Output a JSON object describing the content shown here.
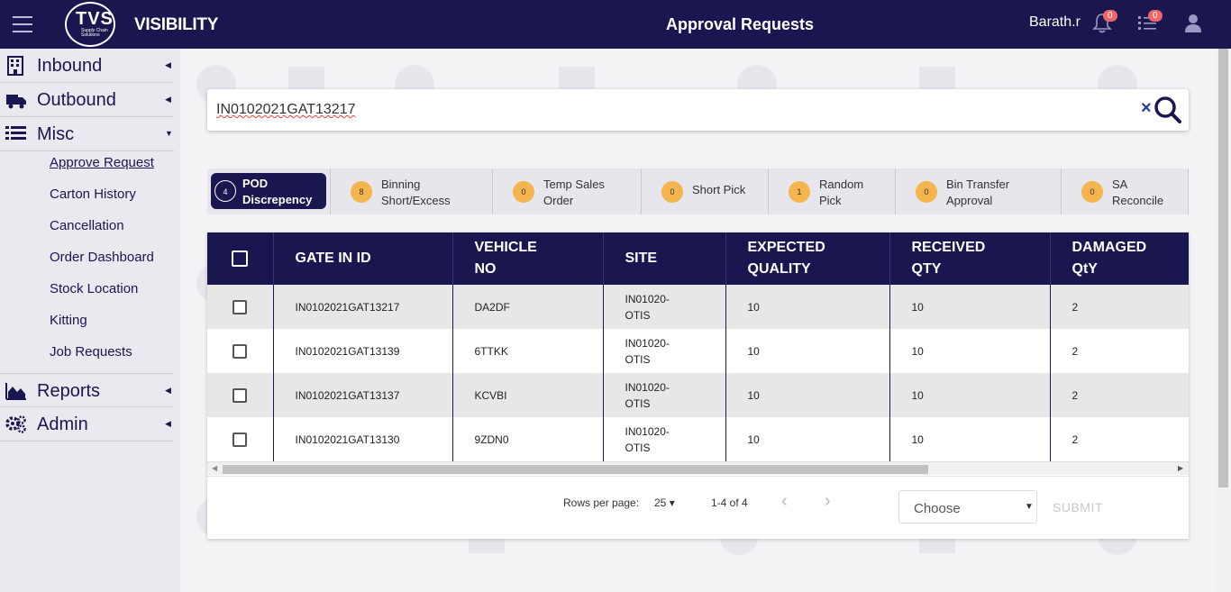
{
  "header": {
    "brand_logo_text": "TVS",
    "brand_logo_sub": "Supply Chain Solutions",
    "app_name": "VISIBILITY",
    "page_title": "Approval Requests",
    "user_name": "Barath.r",
    "notifications_count": "0",
    "tasks_count": "0"
  },
  "sidebar": {
    "inbound": "Inbound",
    "outbound": "Outbound",
    "misc": "Misc",
    "misc_items": [
      "Approve Request",
      "Carton History",
      "Cancellation",
      "Order Dashboard",
      "Stock Location",
      "Kitting",
      "Job Requests"
    ],
    "reports": "Reports",
    "admin": "Admin"
  },
  "search": {
    "value": "IN0102021GAT13217"
  },
  "tabs": [
    {
      "count": "4",
      "l1": "POD",
      "l2": "Discrepency"
    },
    {
      "count": "8",
      "l1": "Binning",
      "l2": "Short/Excess"
    },
    {
      "count": "0",
      "l1": "Temp Sales",
      "l2": "Order"
    },
    {
      "count": "0",
      "l1": "Short Pick",
      "l2": ""
    },
    {
      "count": "1",
      "l1": "Random",
      "l2": "Pick"
    },
    {
      "count": "0",
      "l1": "Bin Transfer",
      "l2": "Approval"
    },
    {
      "count": "0",
      "l1": "SA",
      "l2": "Reconcile"
    }
  ],
  "table": {
    "columns": {
      "gate_in_id": "GATE IN ID",
      "vehicle_1": "VEHICLE",
      "vehicle_2": "NO",
      "site": "SITE",
      "expected_1": "EXPECTED",
      "expected_2": "QUALITY",
      "received_1": "RECEIVED",
      "received_2": "QTY",
      "damaged_1": "DAMAGED",
      "damaged_2": "QtY"
    },
    "rows": [
      {
        "gate_in_id": "IN0102021GAT13217",
        "vehicle_no": "DA2DF",
        "site_1": "IN01020-",
        "site_2": "OTIS",
        "expected": "10",
        "received": "10",
        "damaged": "2"
      },
      {
        "gate_in_id": "IN0102021GAT13139",
        "vehicle_no": "6TTKK",
        "site_1": "IN01020-",
        "site_2": "OTIS",
        "expected": "10",
        "received": "10",
        "damaged": "2"
      },
      {
        "gate_in_id": "IN0102021GAT13137",
        "vehicle_no": "KCVBI",
        "site_1": "IN01020-",
        "site_2": "OTIS",
        "expected": "10",
        "received": "10",
        "damaged": "2"
      },
      {
        "gate_in_id": "IN0102021GAT13130",
        "vehicle_no": "9ZDN0",
        "site_1": "IN01020-",
        "site_2": "OTIS",
        "expected": "10",
        "received": "10",
        "damaged": "2"
      }
    ]
  },
  "pager": {
    "rows_per_page_label": "Rows per page:",
    "rows_per_page_value": "25",
    "range": "1-4 of 4",
    "choose_placeholder": "Choose",
    "submit_label": "SUBMIT"
  },
  "colors": {
    "primary": "#1a1650",
    "badge": "#f06666",
    "tab_count": "#f5b54e"
  }
}
